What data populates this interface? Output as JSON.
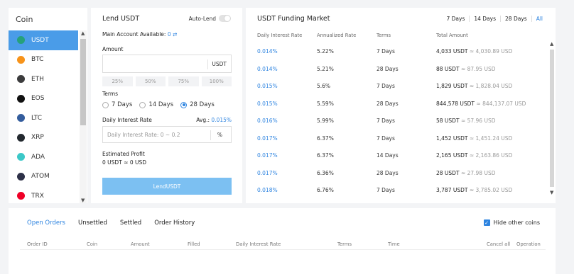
{
  "coin_panel": {
    "title": "Coin",
    "coins": [
      {
        "symbol": "USDT",
        "icon": "usdt-icon",
        "color": "#26a17b",
        "active": true
      },
      {
        "symbol": "BTC",
        "icon": "btc-icon",
        "color": "#f7931a",
        "active": false
      },
      {
        "symbol": "ETH",
        "icon": "eth-icon",
        "color": "#3c3c3d",
        "active": false
      },
      {
        "symbol": "EOS",
        "icon": "eos-icon",
        "color": "#111111",
        "active": false
      },
      {
        "symbol": "LTC",
        "icon": "ltc-icon",
        "color": "#345d9d",
        "active": false
      },
      {
        "symbol": "XRP",
        "icon": "xrp-icon",
        "color": "#23292f",
        "active": false
      },
      {
        "symbol": "ADA",
        "icon": "ada-icon",
        "color": "#3cc8c8",
        "active": false
      },
      {
        "symbol": "ATOM",
        "icon": "atom-icon",
        "color": "#2e3148",
        "active": false
      },
      {
        "symbol": "TRX",
        "icon": "trx-icon",
        "color": "#ef0027",
        "active": false
      }
    ]
  },
  "lend": {
    "title": "Lend USDT",
    "auto_lend_label": "Auto-Lend",
    "main_account_label": "Main Account Available:",
    "main_account_value": "0",
    "transfer_icon": "transfer-icon",
    "amount_label": "Amount",
    "amount_unit": "USDT",
    "percents": [
      "25%",
      "50%",
      "75%",
      "100%"
    ],
    "terms_label": "Terms",
    "terms": [
      {
        "label": "7 Days",
        "selected": false
      },
      {
        "label": "14 Days",
        "selected": false
      },
      {
        "label": "28 Days",
        "selected": true
      }
    ],
    "rate_label": "Daily Interest Rate",
    "avg_label": "Avg.:",
    "avg_value": "0.015%",
    "rate_placeholder": "Daily Interest Rate: 0 ~ 0.2",
    "rate_unit": "%",
    "est_profit_label": "Estimated Profit",
    "est_profit_value": "0 USDT ≈ 0 USD",
    "button_label": "LendUSDT"
  },
  "market": {
    "title": "USDT Funding Market",
    "periods": [
      "7 Days",
      "14 Days",
      "28 Days",
      "All"
    ],
    "headers": [
      "Daily Interest Rate",
      "Annualized Rate",
      "Terms",
      "Total Amount"
    ],
    "rows": [
      {
        "rate": "0.014%",
        "annual": "5.22%",
        "term": "7 Days",
        "total": "4,033 USDT",
        "conv": "≈ 4,030.89 USD"
      },
      {
        "rate": "0.014%",
        "annual": "5.21%",
        "term": "28 Days",
        "total": "88 USDT",
        "conv": "≈ 87.95 USD"
      },
      {
        "rate": "0.015%",
        "annual": "5.6%",
        "term": "7 Days",
        "total": "1,829 USDT",
        "conv": "≈ 1,828.04 USD"
      },
      {
        "rate": "0.015%",
        "annual": "5.59%",
        "term": "28 Days",
        "total": "844,578 USDT",
        "conv": "≈ 844,137.07 USD"
      },
      {
        "rate": "0.016%",
        "annual": "5.99%",
        "term": "7 Days",
        "total": "58 USDT",
        "conv": "≈ 57.96 USD"
      },
      {
        "rate": "0.017%",
        "annual": "6.37%",
        "term": "7 Days",
        "total": "1,452 USDT",
        "conv": "≈ 1,451.24 USD"
      },
      {
        "rate": "0.017%",
        "annual": "6.37%",
        "term": "14 Days",
        "total": "2,165 USDT",
        "conv": "≈ 2,163.86 USD"
      },
      {
        "rate": "0.017%",
        "annual": "6.36%",
        "term": "28 Days",
        "total": "28 USDT",
        "conv": "≈ 27.98 USD"
      },
      {
        "rate": "0.018%",
        "annual": "6.76%",
        "term": "7 Days",
        "total": "3,787 USDT",
        "conv": "≈ 3,785.02 USD"
      }
    ]
  },
  "orders": {
    "tabs": [
      "Open Orders",
      "Unsettled",
      "Settled",
      "Order History"
    ],
    "hide_other_coins_label": "Hide other coins",
    "headers": [
      "Order ID",
      "Coin",
      "Amount",
      "Filled",
      "Daily Interest Rate",
      "Terms",
      "Time"
    ],
    "cancel_all_label": "Cancel all",
    "operation_label": "Operation"
  },
  "colors": {
    "accent": "#2e84e0",
    "active_coin_bg": "#4a9ce8",
    "lend_button": "#7cc0f2"
  }
}
